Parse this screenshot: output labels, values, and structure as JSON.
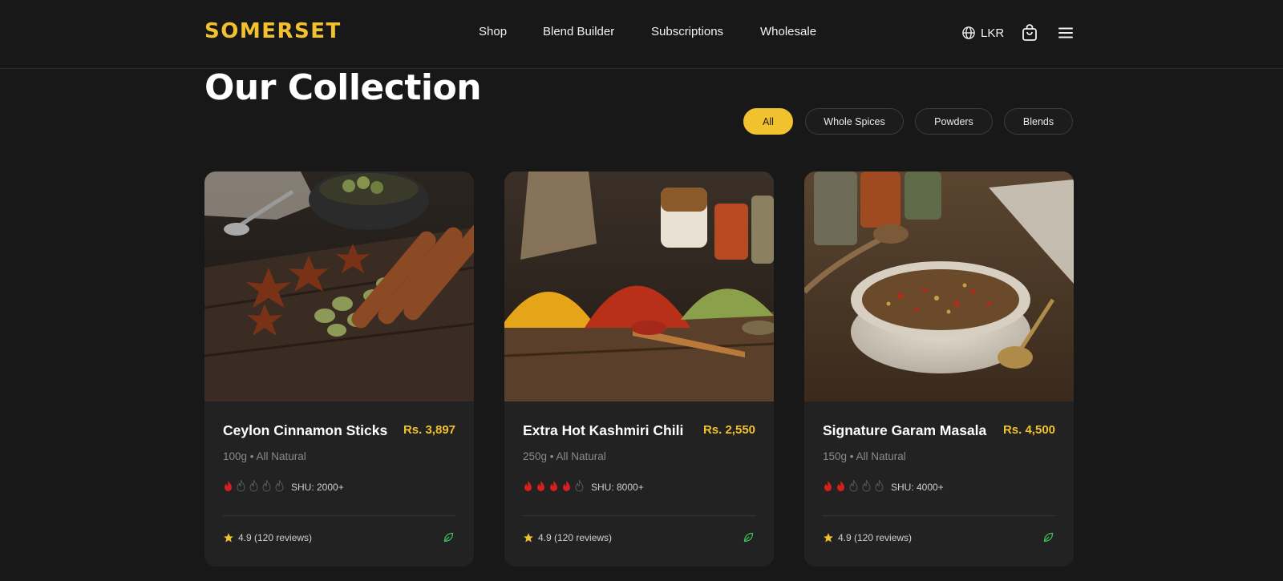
{
  "colors": {
    "accent": "#F2C12E",
    "background": "#181818",
    "card": "#222222",
    "flame_on": "#D42020",
    "leaf": "#3DBE5A"
  },
  "header": {
    "logo": "SOMERSET",
    "nav": [
      "Shop",
      "Blend Builder",
      "Subscriptions",
      "Wholesale"
    ],
    "currency": "LKR",
    "icons": {
      "currency": "globe-icon",
      "cart": "shopping-bag-icon",
      "menu": "hamburger-menu-icon"
    }
  },
  "main": {
    "title": "Our Collection",
    "filters": [
      {
        "label": "All",
        "active": true
      },
      {
        "label": "Whole Spices",
        "active": false
      },
      {
        "label": "Powders",
        "active": false
      },
      {
        "label": "Blends",
        "active": false
      }
    ]
  },
  "products": [
    {
      "name": "Ceylon Cinnamon Sticks",
      "price": "Rs. 3,897",
      "meta": "100g • All Natural",
      "heat_level": 1,
      "heat_max": 5,
      "shu": "SHU: 2000+",
      "rating": "4.9 (120 reviews)",
      "image": "whole spices: star anise, cardamom and cinnamon sticks on dark wood"
    },
    {
      "name": "Extra Hot Kashmiri Chili",
      "price": "Rs. 2,550",
      "meta": "250g • All Natural",
      "heat_level": 4,
      "heat_max": 5,
      "shu": "SHU: 8000+",
      "rating": "4.9 (120 reviews)",
      "image": "mounds of turmeric, chili and green herb powder on a wooden board"
    },
    {
      "name": "Signature Garam Masala",
      "price": "Rs. 4,500",
      "meta": "150g • All Natural",
      "heat_level": 2,
      "heat_max": 5,
      "shu": "SHU: 4000+",
      "rating": "4.9 (120 reviews)",
      "image": "speckled ceramic bowl of mixed spice blend with brass spoon"
    }
  ]
}
